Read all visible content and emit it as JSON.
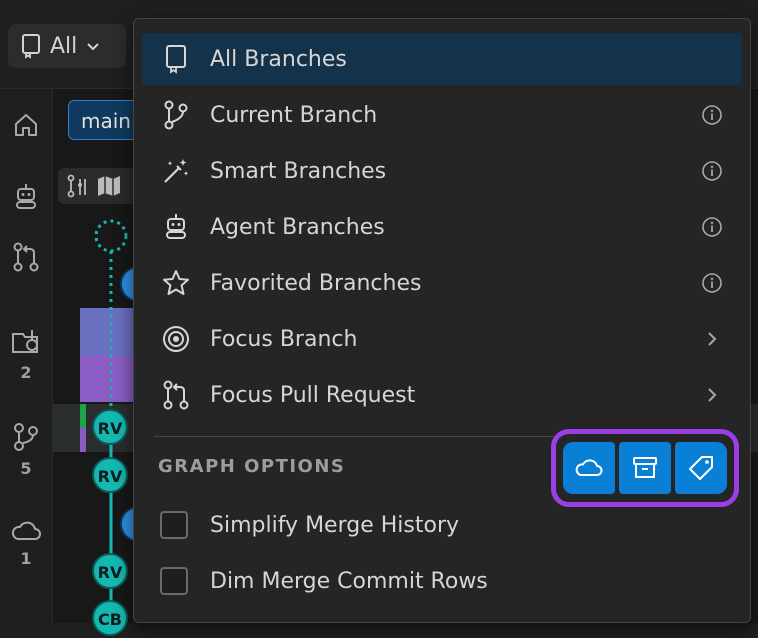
{
  "toolbar": {
    "scope_label": "All"
  },
  "activity_bar": {
    "items": [
      {
        "icon": "home-icon",
        "badge": ""
      },
      {
        "icon": "agent-icon",
        "badge": ""
      },
      {
        "icon": "pull-request-icon",
        "badge": ""
      },
      {
        "icon": "work-items-icon",
        "badge": "2"
      },
      {
        "icon": "branches-icon",
        "badge": "5"
      },
      {
        "icon": "cloud-icon",
        "badge": "1"
      }
    ]
  },
  "graph": {
    "branch_pill": "main",
    "nodes": [
      {
        "label": "RV"
      },
      {
        "label": "RV"
      },
      {
        "label": "RV"
      },
      {
        "label": "CB"
      }
    ],
    "lane_color": "#14b8b0"
  },
  "menu": {
    "items": [
      {
        "label": "All Branches",
        "icon": "repo-icon",
        "trail": "",
        "selected": true
      },
      {
        "label": "Current Branch",
        "icon": "branch-icon",
        "trail": "info-icon"
      },
      {
        "label": "Smart Branches",
        "icon": "magic-wand-icon",
        "trail": "info-icon"
      },
      {
        "label": "Agent Branches",
        "icon": "agent-icon",
        "trail": "info-icon"
      },
      {
        "label": "Favorited Branches",
        "icon": "star-icon",
        "trail": "info-icon"
      },
      {
        "label": "Focus Branch",
        "icon": "target-icon",
        "trail": "chevron-right-icon"
      },
      {
        "label": "Focus Pull Request",
        "icon": "pull-request-icon",
        "trail": "chevron-right-icon"
      }
    ],
    "section_title": "GRAPH OPTIONS",
    "option_buttons": [
      {
        "icon": "cloud-icon"
      },
      {
        "icon": "archive-icon"
      },
      {
        "icon": "tag-icon"
      }
    ],
    "checkboxes": [
      {
        "label": "Simplify Merge History",
        "checked": false
      },
      {
        "label": "Dim Merge Commit Rows",
        "checked": false
      }
    ]
  },
  "colors": {
    "accent": "#0a7fd6",
    "highlight_border": "#9b3ee8",
    "selected_row": "#14324a"
  }
}
